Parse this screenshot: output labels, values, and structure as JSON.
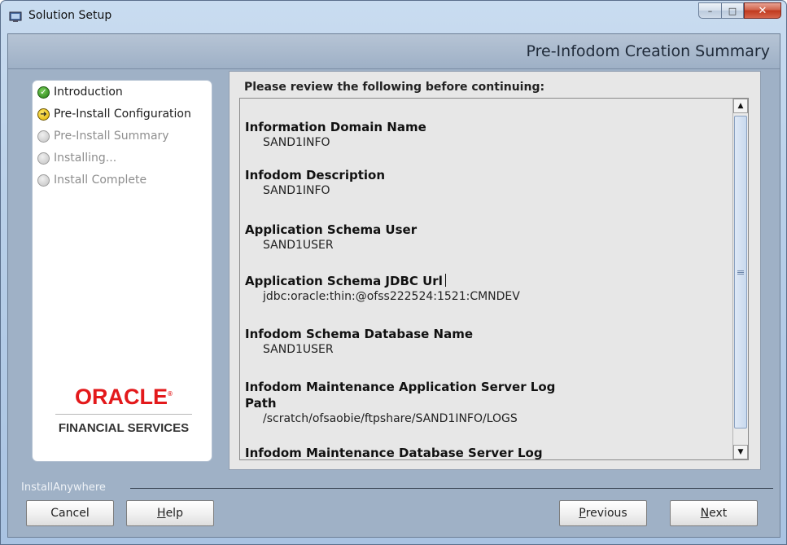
{
  "window": {
    "title": "Solution Setup",
    "controls": {
      "minimize": "–",
      "maximize": "□",
      "close": "✕"
    }
  },
  "header": {
    "title": "Pre-Infodom Creation Summary"
  },
  "steps": [
    {
      "label": "Introduction",
      "state": "done"
    },
    {
      "label": "Pre-Install Configuration",
      "state": "current"
    },
    {
      "label": "Pre-Install Summary",
      "state": "pending"
    },
    {
      "label": "Installing...",
      "state": "pending"
    },
    {
      "label": "Install Complete",
      "state": "pending"
    }
  ],
  "logo": {
    "brand": "ORACLE",
    "reg": "®",
    "subtitle": "FINANCIAL SERVICES"
  },
  "summary": {
    "intro": "Please review the following before continuing:",
    "entries": [
      {
        "title": "Information Domain Name",
        "value": "SAND1INFO"
      },
      {
        "title": "Infodom Description",
        "value": "SAND1INFO"
      },
      {
        "title": "Application Schema User",
        "value": "SAND1USER"
      },
      {
        "title": "Application Schema JDBC Url",
        "value": "jdbc:oracle:thin:@ofss222524:1521:CMNDEV"
      },
      {
        "title": "Infodom Schema Database Name",
        "value": "SAND1USER"
      },
      {
        "title": "Infodom Maintenance Application Server Log",
        "title2": "Path",
        "value": "/scratch/ofsaobie/ftpshare/SAND1INFO/LOGS"
      },
      {
        "title": "Infodom Maintenance Database Server Log",
        "value": ""
      }
    ]
  },
  "footer": {
    "vendor": "InstallAnywhere",
    "buttons": {
      "cancel": "Cancel",
      "help_first": "H",
      "help_rest": "elp",
      "previous_first": "P",
      "previous_rest": "revious",
      "next_first": "N",
      "next_rest": "ext"
    }
  },
  "colors": {
    "accent": "#9fb1c6",
    "oracle_red": "#e3191b",
    "panel": "#e7e7e7"
  }
}
